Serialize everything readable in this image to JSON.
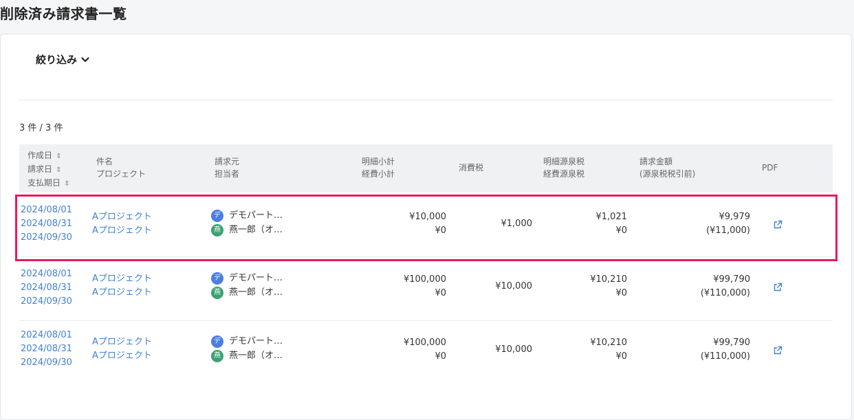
{
  "page": {
    "title": "削除済み請求書一覧"
  },
  "filter": {
    "label": "絞り込み",
    "icon": "chevron-down-icon"
  },
  "count_text": "3 件 / 3 件",
  "colors": {
    "link": "#3f7fd9",
    "highlight": "#e8195f",
    "avatar_blue": "#4a7fe0",
    "avatar_green": "#3aa173"
  },
  "table": {
    "headers": {
      "dates": [
        "作成日",
        "請求日",
        "支払期日"
      ],
      "subject": [
        "件名",
        "プロジェクト"
      ],
      "billing": [
        "請求元",
        "担当者"
      ],
      "subtotal": [
        "明細小計",
        "経費小計"
      ],
      "tax": "消費税",
      "withholding": [
        "明細源泉税",
        "経費源泉税"
      ],
      "amount": [
        "請求金額",
        "(源泉税税引前)"
      ],
      "pdf": "PDF"
    },
    "sort_icon": "sort-icon",
    "rows": [
      {
        "created": "2024/08/01",
        "billed": "2024/08/31",
        "due": "2024/09/30",
        "subject": "Aプロジェクト",
        "project": "Aプロジェクト",
        "partner_avatar": "デ",
        "partner": "デモパート…",
        "person_avatar": "燕",
        "person": "燕一郎（オ…",
        "item_subtotal": "¥10,000",
        "expense_subtotal": "¥0",
        "tax": "¥1,000",
        "item_withholding": "¥1,021",
        "expense_withholding": "¥0",
        "amount": "¥9,979",
        "amount_before": "(¥11,000)"
      },
      {
        "created": "2024/08/01",
        "billed": "2024/08/31",
        "due": "2024/09/30",
        "subject": "Aプロジェクト",
        "project": "Aプロジェクト",
        "partner_avatar": "デ",
        "partner": "デモパート…",
        "person_avatar": "燕",
        "person": "燕一郎（オ…",
        "item_subtotal": "¥100,000",
        "expense_subtotal": "¥0",
        "tax": "¥10,000",
        "item_withholding": "¥10,210",
        "expense_withholding": "¥0",
        "amount": "¥99,790",
        "amount_before": "(¥110,000)"
      },
      {
        "created": "2024/08/01",
        "billed": "2024/08/31",
        "due": "2024/09/30",
        "subject": "Aプロジェクト",
        "project": "Aプロジェクト",
        "partner_avatar": "デ",
        "partner": "デモパート…",
        "person_avatar": "燕",
        "person": "燕一郎（オ…",
        "item_subtotal": "¥100,000",
        "expense_subtotal": "¥0",
        "tax": "¥10,000",
        "item_withholding": "¥10,210",
        "expense_withholding": "¥0",
        "amount": "¥99,790",
        "amount_before": "(¥110,000)"
      }
    ]
  }
}
